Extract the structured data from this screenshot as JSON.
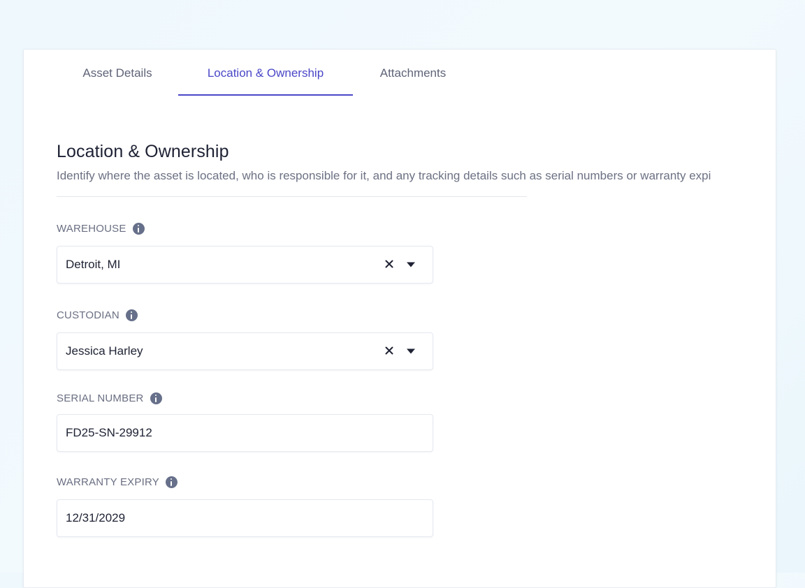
{
  "tabs": [
    {
      "label": "Asset Details",
      "active": false
    },
    {
      "label": "Location & Ownership",
      "active": true
    },
    {
      "label": "Attachments",
      "active": false
    }
  ],
  "section": {
    "title": "Location & Ownership",
    "description": "Identify where the asset is located, who is responsible for it, and any tracking details such as serial numbers or warranty expi"
  },
  "fields": {
    "warehouse": {
      "label": "WAREHOUSE",
      "value": "Detroit, MI",
      "type": "select"
    },
    "custodian": {
      "label": "CUSTODIAN",
      "value": "Jessica Harley",
      "type": "select"
    },
    "serial_number": {
      "label": "SERIAL NUMBER",
      "value": "FD25-SN-29912",
      "type": "text"
    },
    "warranty_expiry": {
      "label": "WARRANTY EXPIRY",
      "value": "12/31/2029",
      "type": "text"
    }
  },
  "icons": {
    "info": "info-icon",
    "clear": "close-icon",
    "dropdown": "caret-down-icon"
  },
  "colors": {
    "accent": "#4a47c7",
    "label": "#6a6f82",
    "info_icon": "#67708a"
  }
}
